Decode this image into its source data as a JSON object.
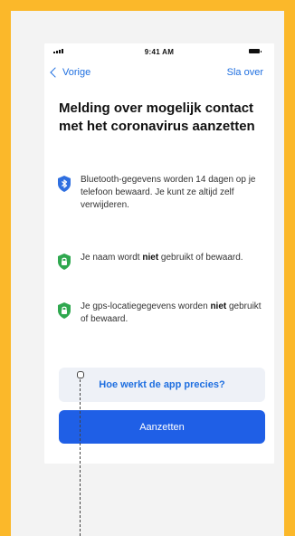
{
  "status_bar": {
    "time": "9:41 AM"
  },
  "nav": {
    "back_label": "Vorige",
    "skip_label": "Sla over"
  },
  "title": "Melding over mogelijk contact met het coronavirus aanzetten",
  "items": [
    {
      "icon": "bluetooth-icon",
      "color": "#2f6fe0",
      "text": "Bluetooth-gegevens worden 14 dagen op je telefoon bewaard. Je kunt ze altijd zelf verwijderen."
    },
    {
      "icon": "shield-lock-icon",
      "color": "#2fa84f",
      "text_parts": [
        "Je naam wordt ",
        "niet",
        " gebruikt of bewaard."
      ]
    },
    {
      "icon": "shield-lock-icon",
      "color": "#2fa84f",
      "text_parts": [
        "Je gps-locatiegegevens worden ",
        "niet",
        " gebruikt of bewaard."
      ]
    }
  ],
  "buttons": {
    "secondary_label": "Hoe werkt de app precies?",
    "primary_label": "Aanzetten"
  },
  "colors": {
    "accent": "#1f5fe6",
    "link": "#1f6fe0",
    "frame": "#FBB82A"
  }
}
